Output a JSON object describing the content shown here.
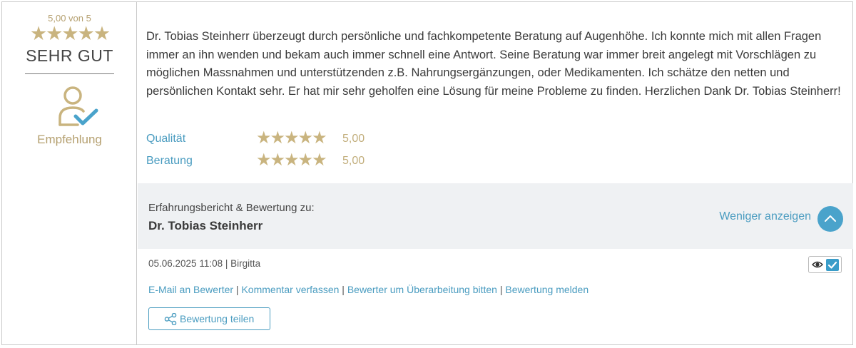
{
  "summary": {
    "score_text": "5,00 von 5",
    "stars": 5,
    "verdict": "SEHR GUT",
    "recommendation_icon": "user-check-icon",
    "recommendation_label": "Empfehlung"
  },
  "review": {
    "text": "Dr. Tobias Steinherr überzeugt durch persönliche und fachkompetente Beratung auf Augenhöhe. Ich konnte mich mit allen Fragen immer an ihn wenden und bekam auch immer schnell eine Antwort. Seine Beratung war immer breit angelegt mit Vorschlägen zu möglichen Massnahmen und unterstützenden z.B. Nahrungsergänzungen, oder Medikamenten. Ich schätze den netten und persönlichen Kontakt sehr. Er hat mir sehr geholfen eine Lösung für meine Probleme zu finden. Herzlichen Dank Dr. Tobias Steinherr!",
    "ratings": [
      {
        "label": "Qualität",
        "stars": 5,
        "value": "5,00"
      },
      {
        "label": "Beratung",
        "stars": 5,
        "value": "5,00"
      }
    ]
  },
  "about": {
    "caption": "Erfahrungsbericht & Bewertung zu:",
    "doctor": "Dr. Tobias Steinherr",
    "less_label": "Weniger anzeigen",
    "toggle_icon": "chevron-up-icon"
  },
  "meta": {
    "text": "05.06.2025 11:08 | Birgitta",
    "visibility_icon": "eye-icon",
    "checked": true
  },
  "actions": {
    "email": "E-Mail an Bewerter",
    "comment": "Kommentar verfassen",
    "revise": "Bewerter um Überarbeitung bitten",
    "report": "Bewertung melden",
    "separator": " | ",
    "share_label": "Bewertung teilen",
    "share_icon": "share-icon"
  },
  "colors": {
    "gold": "#c9b47f",
    "blue": "#4a9cc0",
    "panel": "#eff1f3"
  }
}
